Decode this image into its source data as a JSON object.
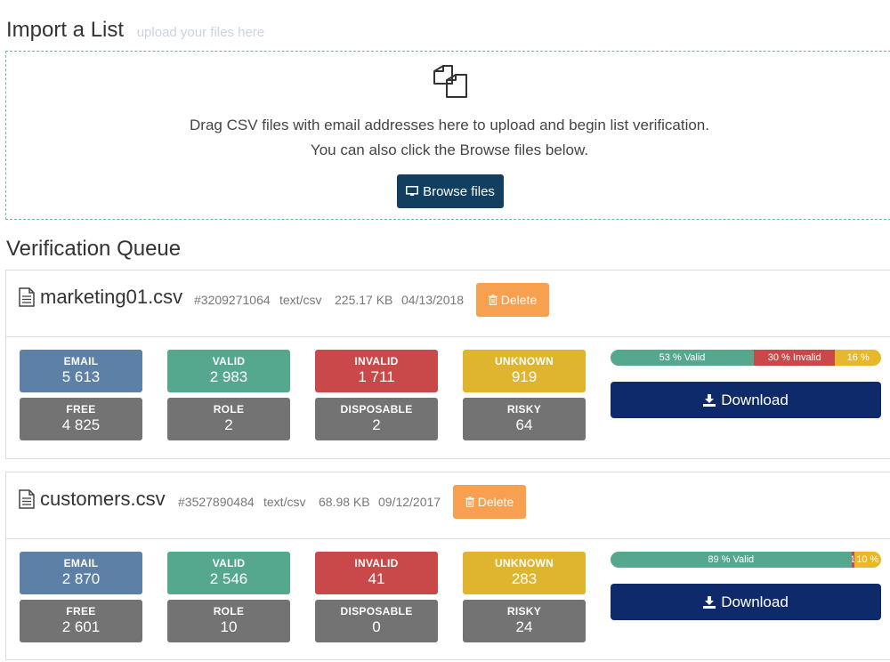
{
  "import": {
    "title": "Import a List",
    "subtitle": "upload your files here",
    "line1": "Drag CSV files with email addresses here to upload and begin list verification.",
    "line2": "You can also click the Browse files below.",
    "browse_label": "Browse files"
  },
  "queue": {
    "title": "Verification Queue",
    "files": [
      {
        "name": "marketing01.csv",
        "id": "#3209271064",
        "type": "text/csv",
        "size": "225.17 KB",
        "date": "04/13/2018",
        "delete_label": "Delete",
        "stats": {
          "email": {
            "label": "EMAIL",
            "value": "5 613"
          },
          "valid": {
            "label": "VALID",
            "value": "2 983"
          },
          "invalid": {
            "label": "INVALID",
            "value": "1 711"
          },
          "unknown": {
            "label": "UNKNOWN",
            "value": "919"
          },
          "free": {
            "label": "FREE",
            "value": "4 825"
          },
          "role": {
            "label": "ROLE",
            "value": "2"
          },
          "disposable": {
            "label": "DISPOSABLE",
            "value": "2"
          },
          "risky": {
            "label": "RISKY",
            "value": "64"
          }
        },
        "progress": {
          "valid_pct": 53,
          "invalid_pct": 30,
          "unknown_pct": 16,
          "valid_label": "53 % Valid",
          "invalid_label": "30 % Invalid",
          "unknown_label": "16 %"
        },
        "download_label": "Download"
      },
      {
        "name": "customers.csv",
        "id": "#3527890484",
        "type": "text/csv",
        "size": "68.98 KB",
        "date": "09/12/2017",
        "delete_label": "Delete",
        "stats": {
          "email": {
            "label": "EMAIL",
            "value": "2 870"
          },
          "valid": {
            "label": "VALID",
            "value": "2 546"
          },
          "invalid": {
            "label": "INVALID",
            "value": "41"
          },
          "unknown": {
            "label": "UNKNOWN",
            "value": "283"
          },
          "free": {
            "label": "FREE",
            "value": "2 601"
          },
          "role": {
            "label": "ROLE",
            "value": "10"
          },
          "disposable": {
            "label": "DISPOSABLE",
            "value": "0"
          },
          "risky": {
            "label": "RISKY",
            "value": "24"
          }
        },
        "progress": {
          "valid_pct": 89,
          "invalid_pct": 1,
          "unknown_pct": 10,
          "valid_label": "89 % Valid",
          "invalid_label": "1",
          "unknown_label": "10 %"
        },
        "download_label": "Download"
      }
    ]
  },
  "colors": {
    "email": "#5d80a6",
    "valid": "#55a78e",
    "invalid": "#c9484a",
    "unknown": "#dfb52f",
    "grey": "#737373",
    "browse": "#123f60",
    "download": "#0f2a6b",
    "delete": "#f7a150"
  }
}
